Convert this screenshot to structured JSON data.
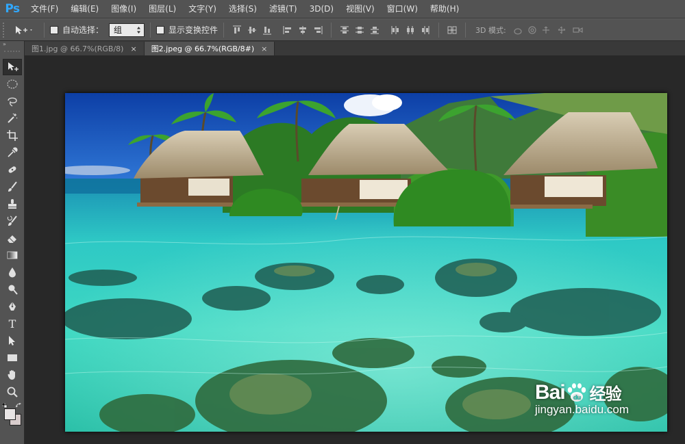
{
  "app": {
    "logo": "Ps"
  },
  "menu": [
    "文件(F)",
    "编辑(E)",
    "图像(I)",
    "图层(L)",
    "文字(Y)",
    "选择(S)",
    "滤镜(T)",
    "3D(D)",
    "视图(V)",
    "窗口(W)",
    "帮助(H)"
  ],
  "options": {
    "auto_select_label": "自动选择：",
    "auto_select_value": "组",
    "show_transform_label": "显示变换控件",
    "mode_3d_label": "3D 模式:"
  },
  "tabs": [
    {
      "label": "图1.jpg @ 66.7%(RGB/8)",
      "close": "×",
      "active": false
    },
    {
      "label": "图2.jpeg @ 66.7%(RGB/8#)",
      "close": "×",
      "active": true
    }
  ],
  "toolbar": {
    "collapse": "»",
    "tools": [
      "move-tool",
      "marquee-tool",
      "lasso-tool",
      "magic-wand-tool",
      "crop-tool",
      "eyedropper-tool",
      "healing-brush-tool",
      "brush-tool",
      "clone-stamp-tool",
      "history-brush-tool",
      "eraser-tool",
      "gradient-tool",
      "blur-tool",
      "dodge-tool",
      "pen-tool",
      "type-tool",
      "path-selection-tool",
      "rectangle-tool",
      "hand-tool",
      "zoom-tool"
    ],
    "type_glyph": "T",
    "foreground_color": "#e8e4e4",
    "background_color": "#d8cccc"
  },
  "watermark": {
    "brand_left": "Bai",
    "brand_right": "经验",
    "url": "jingyan.baidu.com"
  }
}
